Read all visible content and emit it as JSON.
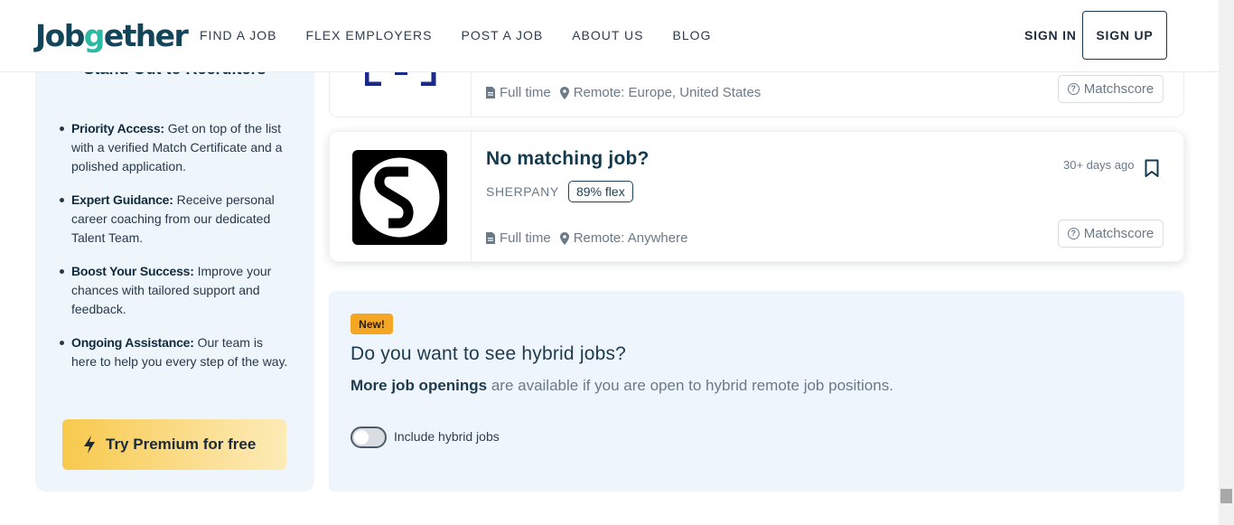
{
  "header": {
    "logo_text_before": "Job",
    "logo_text_g": "g",
    "logo_text_after": "ether",
    "nav": [
      "FIND A JOB",
      "FLEX EMPLOYERS",
      "POST A JOB",
      "ABOUT US",
      "BLOG"
    ],
    "sign_in": "SIGN IN",
    "sign_up": "SIGN UP"
  },
  "sidebar": {
    "title": "Stand Out to Recruiters",
    "items": [
      {
        "bold": "Priority Access:",
        "text": " Get on top of the list with a verified Match Certificate and a polished application."
      },
      {
        "bold": "Expert Guidance:",
        "text": " Receive personal career coaching from our dedicated Talent Team."
      },
      {
        "bold": "Boost Your Success:",
        "text": " Improve your chances with tailored support and feedback."
      },
      {
        "bold": "Ongoing Assistance:",
        "text": " Our team is here to help you every step of the way."
      }
    ],
    "cta": "Try Premium for free"
  },
  "jobs": [
    {
      "type": "Full time",
      "location": "Remote: Europe, United States",
      "matchscore": "Matchscore"
    },
    {
      "title": "No matching job?",
      "company": "SHERPANY",
      "flex": "89% flex",
      "posted": "30+ days ago",
      "type": "Full time",
      "location": "Remote: Anywhere",
      "matchscore": "Matchscore"
    }
  ],
  "hybrid": {
    "badge": "New!",
    "title": "Do you want to see hybrid jobs?",
    "desc_bold": "More job openings",
    "desc_rest": " are available if you are open to hybrid remote job positions.",
    "toggle_label": "Include hybrid jobs",
    "toggle_on": false
  },
  "colors": {
    "brand_dark": "#124559",
    "brand_teal": "#2bb9a4",
    "premium_yellow": "#f8c94c",
    "new_badge": "#f5a623",
    "panel_bg": "#eef5fc"
  }
}
